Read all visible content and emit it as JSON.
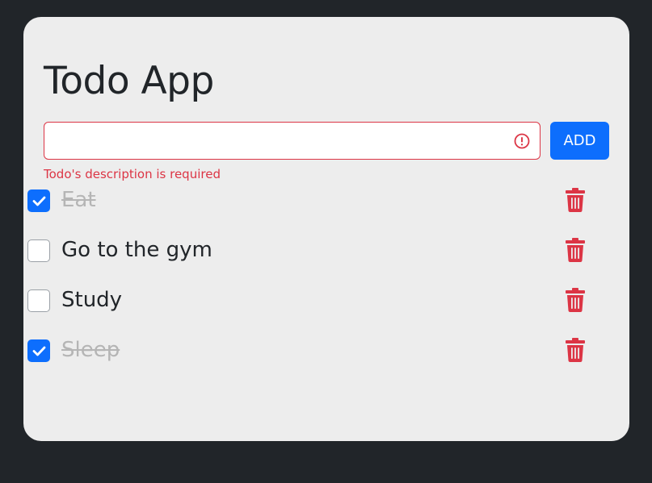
{
  "app": {
    "title": "Todo App"
  },
  "form": {
    "input_value": "",
    "add_label": "ADD",
    "error_message": "Todo's description is required"
  },
  "todos": [
    {
      "label": "Eat",
      "done": true
    },
    {
      "label": "Go to the gym",
      "done": false
    },
    {
      "label": "Study",
      "done": false
    },
    {
      "label": "Sleep",
      "done": true
    }
  ],
  "colors": {
    "page_background": "#212529",
    "card_background": "#ededed",
    "primary": "#0d6efd",
    "danger": "#dc3545",
    "completed_text": "#b5b5b5"
  },
  "icons": {
    "input_status": "exclamation-circle-icon",
    "delete": "trash-icon",
    "check": "checkmark-icon"
  }
}
